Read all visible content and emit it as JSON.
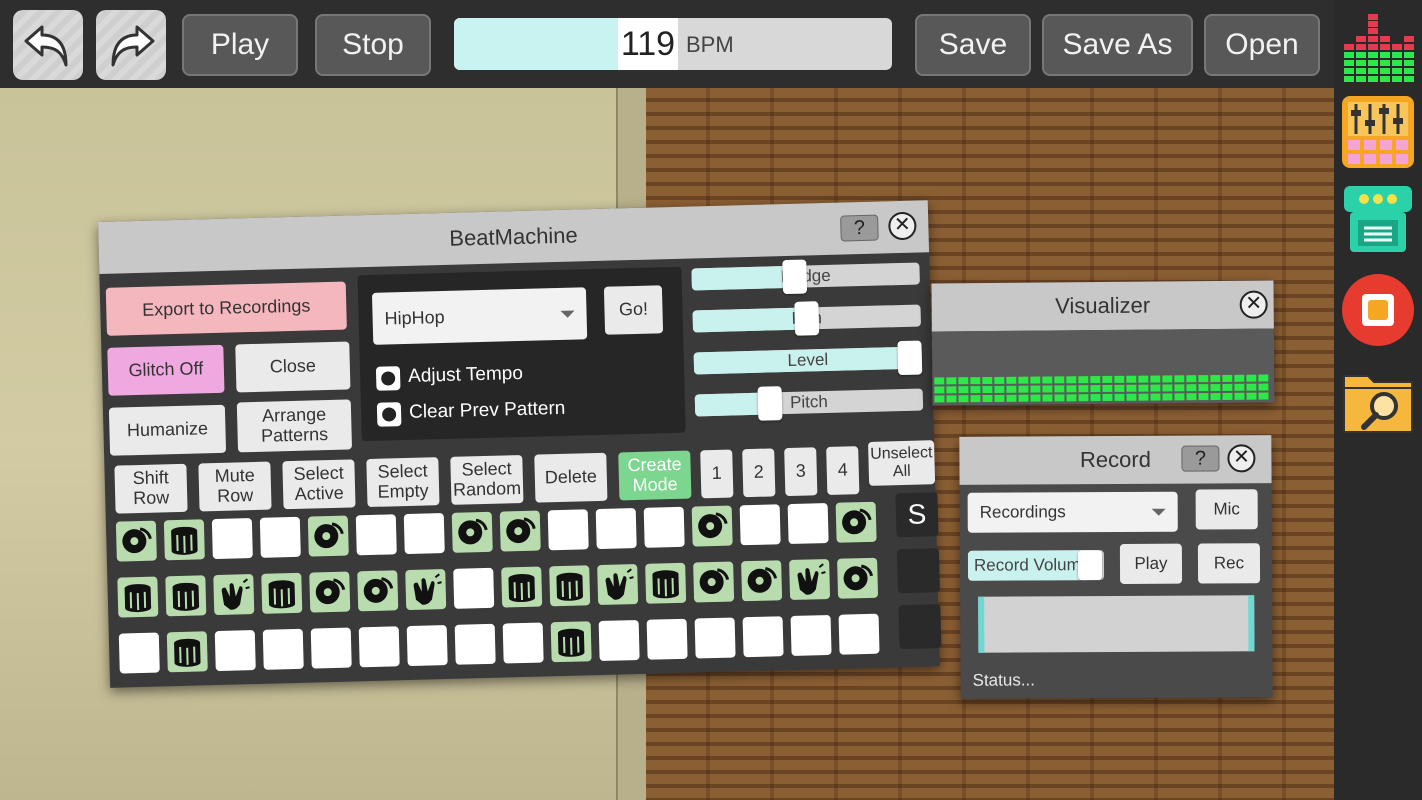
{
  "toolbar": {
    "undo_icon": "undo-arrow-icon",
    "redo_icon": "redo-arrow-icon",
    "play": "Play",
    "stop": "Stop",
    "tempo_value": "119",
    "tempo_unit": "BPM",
    "save": "Save",
    "save_as": "Save As",
    "open": "Open"
  },
  "sidebar": {
    "items": [
      "equalizer-icon",
      "mixer-icon",
      "synth-machine-icon",
      "record-icon",
      "folder-search-icon"
    ]
  },
  "beatmachine": {
    "title": "BeatMachine",
    "help": "?",
    "export": "Export to Recordings",
    "glitch": "Glitch Off",
    "close": "Close",
    "humanize": "Humanize",
    "arrange_l1": "Arrange",
    "arrange_l2": "Patterns",
    "style_selected": "HipHop",
    "go": "Go!",
    "adjust_tempo": "Adjust Tempo",
    "clear_prev": "Clear Prev Pattern",
    "sliders": {
      "nudge": {
        "label": "Nudge",
        "value": 0.45
      },
      "pan": {
        "label": "Pan",
        "value": 0.5
      },
      "level": {
        "label": "Level",
        "value": 1.0
      },
      "pitch": {
        "label": "Pitch",
        "value": 0.33
      }
    },
    "shift_l1": "Shift",
    "shift_l2": "Row",
    "mute_l1": "Mute",
    "mute_l2": "Row",
    "selact_l1": "Select",
    "selact_l2": "Active",
    "selempty_l1": "Select",
    "selempty_l2": "Empty",
    "selrand_l1": "Select",
    "selrand_l2": "Random",
    "delete": "Delete",
    "create_l1": "Create",
    "create_l2": "Mode",
    "pages": [
      "1",
      "2",
      "3",
      "4"
    ],
    "unselect_l1": "Unselect",
    "unselect_l2": "All",
    "solo": "S",
    "grid": [
      [
        "disc",
        "drum",
        "empty",
        "empty",
        "disc",
        "empty",
        "empty",
        "disc",
        "disc",
        "empty",
        "empty",
        "empty",
        "disc",
        "empty",
        "empty",
        "disc"
      ],
      [
        "drum",
        "drum",
        "clap",
        "drum",
        "disc",
        "disc",
        "clap",
        "empty",
        "drum",
        "drum",
        "clap",
        "drum",
        "disc",
        "disc",
        "clap",
        "disc"
      ],
      [
        "empty",
        "drum",
        "empty",
        "empty",
        "empty",
        "empty",
        "empty",
        "empty",
        "empty",
        "drum",
        "empty",
        "empty",
        "empty",
        "empty",
        "empty",
        "empty"
      ]
    ]
  },
  "visualizer": {
    "title": "Visualizer",
    "bar_color": "#2ee84a"
  },
  "record": {
    "title": "Record",
    "help": "?",
    "source": "Recordings",
    "mic": "Mic",
    "volume_label": "Record Volume",
    "volume_value": 0.9,
    "play": "Play",
    "rec": "Rec",
    "status": "Status..."
  }
}
